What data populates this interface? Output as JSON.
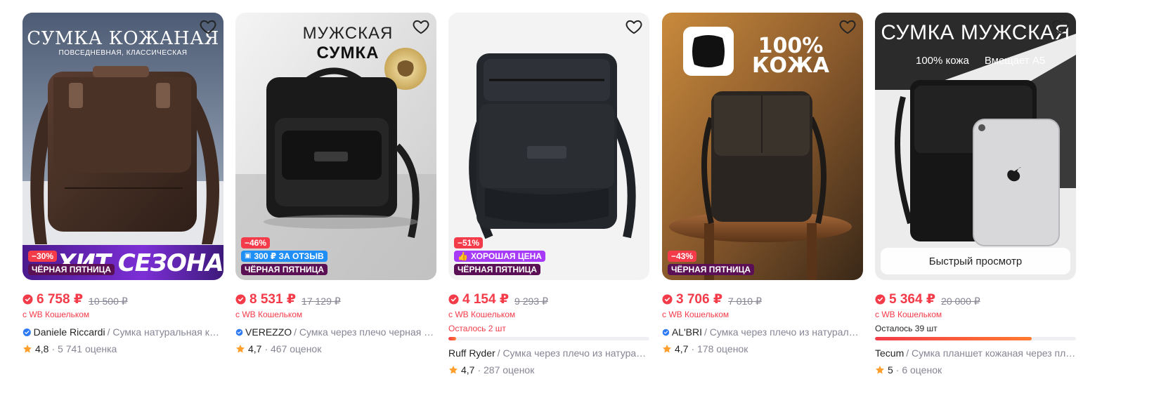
{
  "colors": {
    "price": "#f33b49",
    "black_friday": "#5b0f54",
    "discount": "#f33b49",
    "muted": "#868695"
  },
  "icons": {
    "favorite": "heart-outline-icon",
    "wallet_price": "wallet-badge-icon",
    "rating": "star-icon",
    "verified": "verified-check-icon"
  },
  "cards": [
    {
      "image_text": {
        "line1": "СУМКА КОЖАНАЯ",
        "line2": "ПОВСЕДНЕВНАЯ, КЛАССИЧЕСКАЯ"
      },
      "banner": "ХИТ СЕЗОНА",
      "discount": "−30%",
      "black_friday": "ЧЁРНАЯ ПЯТНИЦА",
      "price": "6 758 ₽",
      "old_price": "10 500 ₽",
      "wallet": "с WB Кошельком",
      "brand": "Daniele Riccardi",
      "name": "/ Сумка натуральная кожа",
      "rating": "4,8",
      "reviews": "· 5 741 оценка"
    },
    {
      "image_text": {
        "line1": "МУЖСКАЯ",
        "line2": "СУМКА"
      },
      "discount": "−46%",
      "review_badge": "300 ₽ ЗА ОТЗЫВ",
      "black_friday": "ЧЁРНАЯ ПЯТНИЦА",
      "price": "8 531 ₽",
      "old_price": "17 129 ₽",
      "wallet": "с WB Кошельком",
      "brand": "VEREZZO",
      "name": "/ Сумка через плечо черная кожаная",
      "rating": "4,7",
      "reviews": "· 467 оценок"
    },
    {
      "discount": "−51%",
      "good_price": "ХОРОШАЯ ЦЕНА",
      "black_friday": "ЧЁРНАЯ ПЯТНИЦА",
      "price": "4 154 ₽",
      "old_price": "9 293 ₽",
      "wallet": "с WB Кошельком",
      "stock": "Осталось 2 шт",
      "stock_fraction": 0.04,
      "brand": "Ruff Ryder",
      "name": "/ Сумка через плечо из натуральной кожи",
      "rating": "4,7",
      "reviews": "· 287 оценок"
    },
    {
      "image_text": {
        "line1": "100%",
        "line2": "КОЖА"
      },
      "discount": "−43%",
      "black_friday": "ЧЁРНАЯ ПЯТНИЦА",
      "price": "3 706 ₽",
      "old_price": "7 010 ₽",
      "wallet": "с WB Кошельком",
      "brand": "AL'BRI",
      "name": "/ Сумка через плечо из натуральной кожи",
      "rating": "4,7",
      "reviews": "· 178 оценок"
    },
    {
      "image_text": {
        "line1": "СУМКА МУЖСКАЯ",
        "line2": "100% кожа",
        "line3": "Вмещает А5"
      },
      "quick_view": "Быстрый просмотр",
      "price": "5 364 ₽",
      "old_price": "20 000 ₽",
      "wallet": "с WB Кошельком",
      "stock": "Осталось 39 шт",
      "stock_fraction": 0.78,
      "brand": "Tecum",
      "name": "/ Сумка планшет кожаная через плечо",
      "rating": "5",
      "reviews": "· 6 оценок"
    }
  ]
}
